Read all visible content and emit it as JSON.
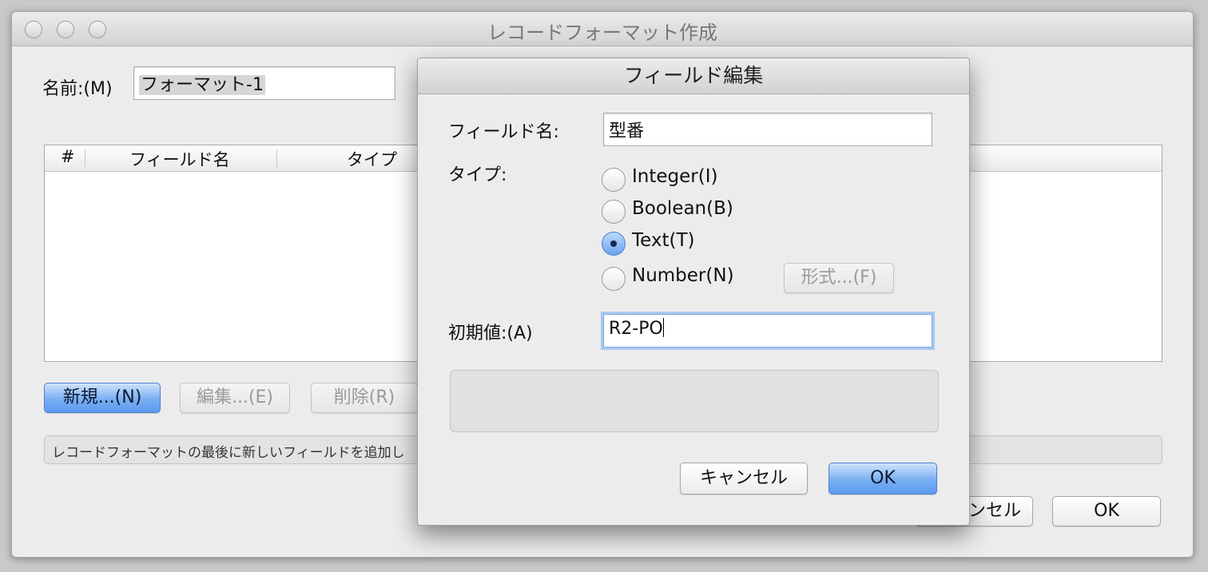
{
  "window": {
    "title": "レコードフォーマット作成",
    "name_label": "名前:(M)",
    "name_value": "フォーマット-1",
    "table": {
      "columns": [
        "#",
        "フィールド名",
        "タイプ"
      ]
    },
    "buttons": {
      "new": "新規...(N)",
      "edit": "編集...(E)",
      "delete": "削除(R)",
      "cancel_partial": "ンセル",
      "ok": "OK"
    },
    "status_text": "レコードフォーマットの最後に新しいフィールドを追加し"
  },
  "dialog": {
    "title": "フィールド編集",
    "field_name_label": "フィールド名:",
    "field_name_value": "型番",
    "type_label": "タイプ:",
    "types": [
      "Integer(I)",
      "Boolean(B)",
      "Text(T)",
      "Number(N)"
    ],
    "selected_type": "Text(T)",
    "format_button": "形式...(F)",
    "initial_label": "初期値:(A)",
    "initial_value": "R2-PO",
    "cancel": "キャンセル",
    "ok": "OK"
  }
}
